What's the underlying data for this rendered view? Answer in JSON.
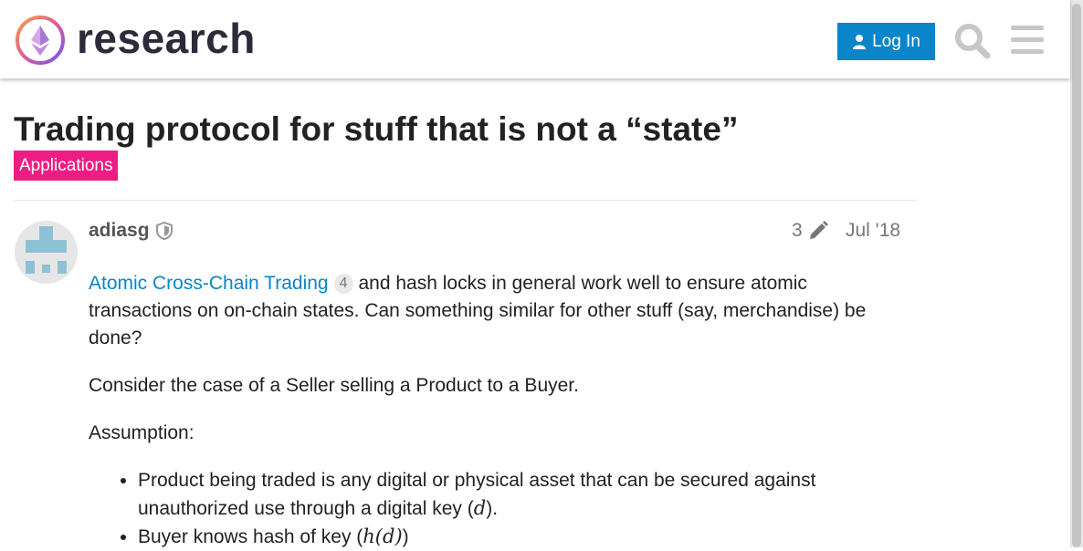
{
  "header": {
    "site_name": "research",
    "login_label": "Log In"
  },
  "topic": {
    "title": "Trading protocol for stuff that is not a “state”",
    "category": "Applications",
    "category_color": "#ee1c83"
  },
  "post": {
    "author": "adiasg",
    "edit_count": "3",
    "date": "Jul '18",
    "link_text": "Atomic Cross-Chain Trading",
    "link_clicks": "4",
    "para1_rest": "and hash locks in general work well to ensure atomic transactions on on-chain states. Can something similar for other stuff (say, merchandise) be done?",
    "para2": "Consider the case of a Seller selling a Product to a Buyer.",
    "para3": "Assumption:",
    "bullets": [
      {
        "pre": "Product being traded is any digital or physical asset that can be secured against unauthorized use through a digital key (",
        "math": "d",
        "post": ")."
      },
      {
        "pre": "Buyer knows hash of key (",
        "math": "h(d)",
        "post": ")"
      }
    ]
  },
  "colors": {
    "accent": "#0a85c9",
    "category": "#ee1c83"
  }
}
